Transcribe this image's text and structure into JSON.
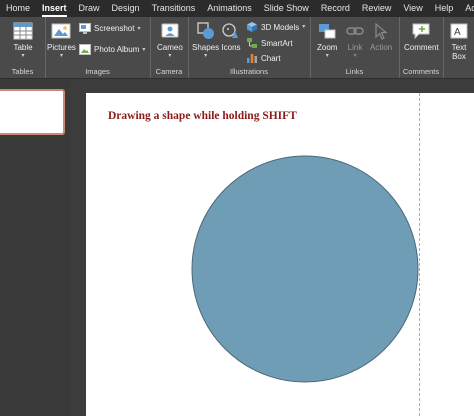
{
  "tabs": [
    {
      "label": "Home",
      "active": false
    },
    {
      "label": "Insert",
      "active": true
    },
    {
      "label": "Draw",
      "active": false
    },
    {
      "label": "Design",
      "active": false
    },
    {
      "label": "Transitions",
      "active": false
    },
    {
      "label": "Animations",
      "active": false
    },
    {
      "label": "Slide Show",
      "active": false
    },
    {
      "label": "Record",
      "active": false
    },
    {
      "label": "Review",
      "active": false
    },
    {
      "label": "View",
      "active": false
    },
    {
      "label": "Help",
      "active": false
    },
    {
      "label": "Acrobat",
      "active": false
    }
  ],
  "ribbon": {
    "tables": {
      "group_label": "Tables",
      "table_label": "Table"
    },
    "images": {
      "group_label": "Images",
      "pictures_label": "Pictures",
      "screenshot_label": "Screenshot",
      "photo_album_label": "Photo Album"
    },
    "camera": {
      "group_label": "Camera",
      "cameo_label": "Cameo"
    },
    "illustrations": {
      "group_label": "Illustrations",
      "shapes_label": "Shapes",
      "icons_label": "Icons",
      "models_label": "3D Models",
      "smartart_label": "SmartArt",
      "chart_label": "Chart"
    },
    "links": {
      "group_label": "Links",
      "zoom_label": "Zoom",
      "link_label": "Link",
      "action_label": "Action"
    },
    "comments": {
      "group_label": "Comments",
      "comment_label": "Comment"
    },
    "text": {
      "textbox_label_1": "Text",
      "textbox_label_2": "Box"
    }
  },
  "slide": {
    "title": "Drawing a shape while holding SHIFT",
    "shape_fill": "#6e9db5",
    "shape_stroke": "#4d6777"
  },
  "colors": {
    "title_color": "#8b1a1a",
    "active_tab": "#ffffff",
    "thumb_border": "#c98a7a"
  }
}
